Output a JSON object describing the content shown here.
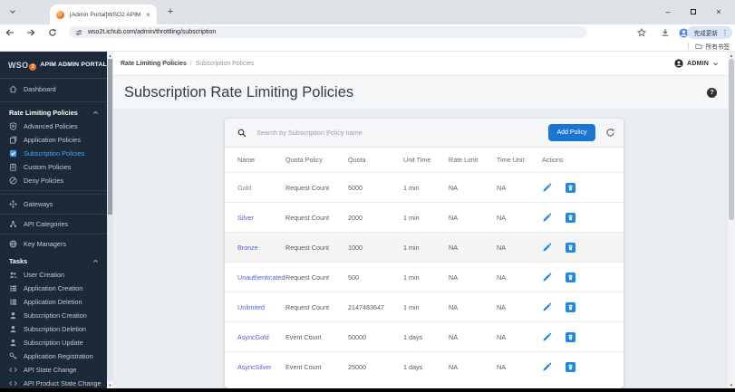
{
  "browser": {
    "tab_title": "[Admin Portal]WSO2 APIM",
    "url": "wso2t.ichub.com/admin/throttling/subscription",
    "update_chip_label": "完成更新",
    "bookmarks_bar_label": "所有书签"
  },
  "sidebar": {
    "logo": {
      "brand": "WSO",
      "brand_sub": "2",
      "title": "APIM ADMIN PORTAL"
    },
    "groups": [
      {
        "type": "top",
        "items": [
          {
            "label": "Dashboard",
            "icon": "home-icon"
          }
        ]
      },
      {
        "type": "section",
        "label": "Rate Limiting Policies",
        "items": [
          {
            "label": "Advanced Policies",
            "icon": "shield-icon"
          },
          {
            "label": "Application Policies",
            "icon": "layers-icon"
          },
          {
            "label": "Subscription Policies",
            "icon": "checkbox-icon",
            "active": true
          },
          {
            "label": "Custom Policies",
            "icon": "clipboard-icon"
          },
          {
            "label": "Deny Policies",
            "icon": "block-icon"
          }
        ]
      },
      {
        "type": "mid",
        "items": [
          {
            "label": "Gateways",
            "icon": "gateway-icon"
          },
          {
            "label": "API Categories",
            "icon": "categories-icon"
          },
          {
            "label": "Key Managers",
            "icon": "globe-shield-icon"
          }
        ]
      },
      {
        "type": "section",
        "label": "Tasks",
        "items": [
          {
            "label": "User Creation",
            "icon": "users-icon"
          },
          {
            "label": "Application Creation",
            "icon": "list-icon"
          },
          {
            "label": "Application Deletion",
            "icon": "list-icon"
          },
          {
            "label": "Subscription Creation",
            "icon": "person-icon"
          },
          {
            "label": "Subscription Deletion",
            "icon": "person-icon"
          },
          {
            "label": "Subscription Update",
            "icon": "person-icon"
          },
          {
            "label": "Application Registration",
            "icon": "key-icon"
          },
          {
            "label": "API State Change",
            "icon": "code-icon"
          },
          {
            "label": "API Product State Change",
            "icon": "code-icon"
          }
        ]
      }
    ]
  },
  "header": {
    "breadcrumb": {
      "parent": "Rate Limiting Policies",
      "separator": "/",
      "current": "Subscription Policies"
    },
    "user_menu_label": "ADMIN"
  },
  "page": {
    "title": "Subscription Rate Limiting Policies"
  },
  "toolbar": {
    "search_placeholder": "Search by Subscription Policy name",
    "add_policy_label": "Add Policy",
    "icons": [
      "search-icon",
      "refresh-icon"
    ]
  },
  "table": {
    "columns": [
      "Name",
      "Quota Policy",
      "Quota",
      "Unit Time",
      "Rate Limit",
      "Time Unit",
      "Actions"
    ],
    "action_icons": [
      "edit-icon",
      "delete-icon"
    ],
    "rows": [
      {
        "name": "Gold",
        "quota_policy": "Request Count",
        "quota": "5000",
        "unit_time": "1 min",
        "rate_limit": "NA",
        "time_unit": "NA",
        "name_visited": true
      },
      {
        "name": "Silver",
        "quota_policy": "Request Count",
        "quota": "2000",
        "unit_time": "1 min",
        "rate_limit": "NA",
        "time_unit": "NA"
      },
      {
        "name": "Bronze",
        "quota_policy": "Request Count",
        "quota": "1000",
        "unit_time": "1 min",
        "rate_limit": "NA",
        "time_unit": "NA",
        "hovered": true
      },
      {
        "name": "Unauthenticated",
        "quota_policy": "Request Count",
        "quota": "500",
        "unit_time": "1 min",
        "rate_limit": "NA",
        "time_unit": "NA"
      },
      {
        "name": "Unlimited",
        "quota_policy": "Request Count",
        "quota": "2147483647",
        "unit_time": "1 min",
        "rate_limit": "NA",
        "time_unit": "NA"
      },
      {
        "name": "AsyncGold",
        "quota_policy": "Event Count",
        "quota": "50000",
        "unit_time": "1 days",
        "rate_limit": "NA",
        "time_unit": "NA"
      },
      {
        "name": "AsyncSilver",
        "quota_policy": "Event Count",
        "quota": "25000",
        "unit_time": "1 days",
        "rate_limit": "NA",
        "time_unit": "NA"
      }
    ]
  },
  "colors": {
    "sidebar_bg": "#1c2938",
    "active_item": "#47a9f8",
    "accent_blue": "#1b76d2",
    "link": "#5560d6",
    "visited_link": "#8d7bb0",
    "content_bg": "#e9edf0"
  }
}
